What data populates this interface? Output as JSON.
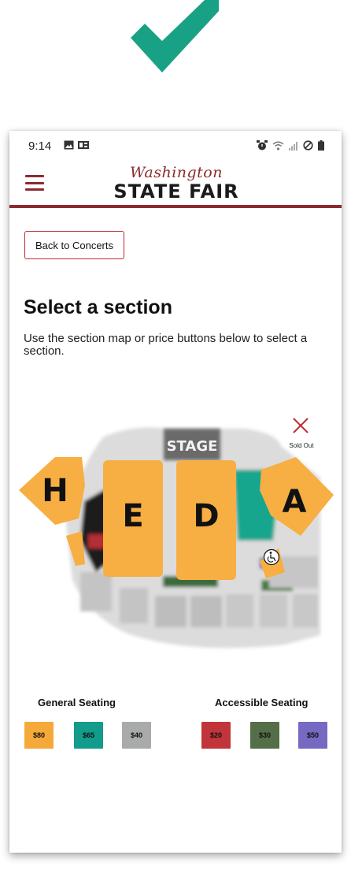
{
  "colors": {
    "brand_red": "#8b2b2f",
    "check_green": "#19a186",
    "section_orange": "#f7ae42",
    "price_80": "#f5a93a",
    "price_65": "#119c8b",
    "price_40": "#a8aba9",
    "price_20": "#c0343a",
    "price_30": "#546e47",
    "price_50": "#7569c2"
  },
  "status_bar": {
    "time": "9:14",
    "left_icons": [
      "image-icon",
      "sim-card-icon"
    ],
    "right_icons": [
      "alarm-icon",
      "wifi-icon",
      "signal-icon",
      "do-not-disturb-icon",
      "battery-icon"
    ]
  },
  "header": {
    "menu_icon": "hamburger-menu-icon",
    "logo_script": "Washington",
    "logo_main": "STATE FAIR"
  },
  "back_button_label": "Back to Concerts",
  "page": {
    "title": "Select a section",
    "description": "Use the section map or price buttons below to select a section."
  },
  "map": {
    "stage_label": "STAGE",
    "sections": [
      {
        "label": "H",
        "price": "$80"
      },
      {
        "label": "E",
        "price": "$80"
      },
      {
        "label": "D",
        "price": "$80"
      },
      {
        "label": "A",
        "price": "$80"
      }
    ],
    "accessible_icon": "wheelchair-icon"
  },
  "legend": {
    "sold_out_icon": "close-x-icon",
    "sold_out_label": "Sold Out",
    "general_title": "General Seating",
    "accessible_title": "Accessible Seating",
    "general_prices": [
      {
        "label": "$80",
        "color": "#f5a93a"
      },
      {
        "label": "$65",
        "color": "#119c8b"
      },
      {
        "label": "$40",
        "color": "#a8aba9"
      }
    ],
    "accessible_prices": [
      {
        "label": "$20",
        "color": "#c0343a"
      },
      {
        "label": "$30",
        "color": "#546e47"
      },
      {
        "label": "$50",
        "color": "#7569c2"
      }
    ]
  }
}
